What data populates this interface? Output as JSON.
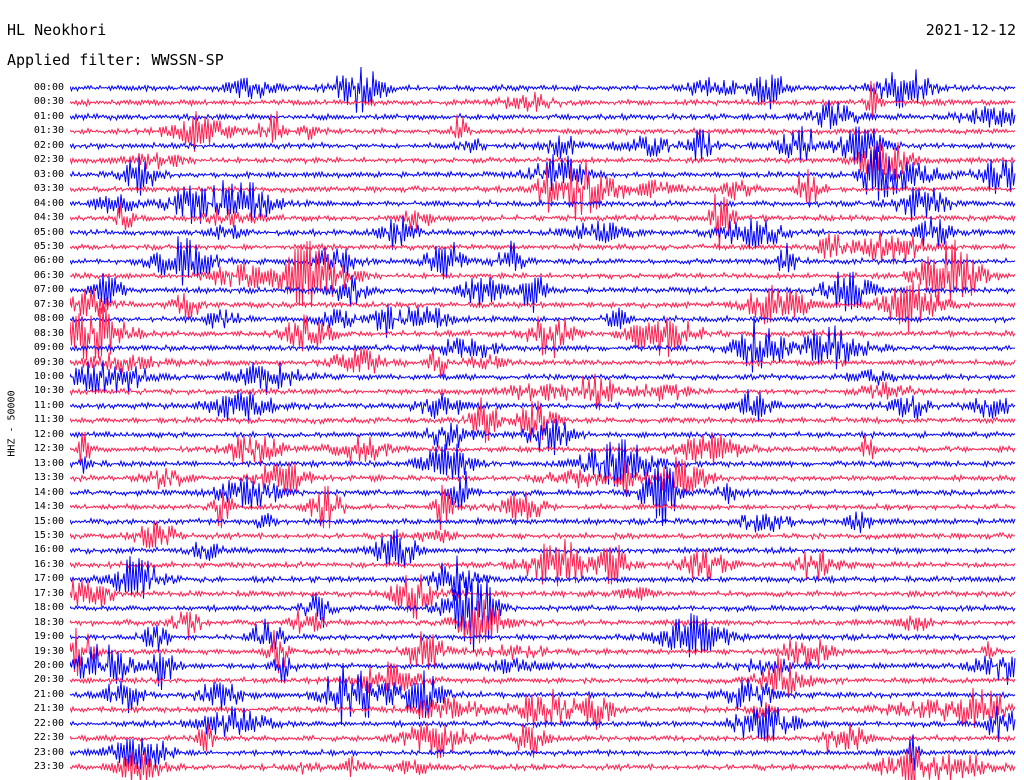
{
  "header": {
    "station": "HL Neokhori",
    "date": "2021-12-12",
    "filter": "Applied filter: WWSSN-SP"
  },
  "axis": {
    "channel_label": "HHZ - 50000"
  },
  "rows": [
    "00:00",
    "00:30",
    "01:00",
    "01:30",
    "02:00",
    "02:30",
    "03:00",
    "03:30",
    "04:00",
    "04:30",
    "05:00",
    "05:30",
    "06:00",
    "06:30",
    "07:00",
    "07:30",
    "08:00",
    "08:30",
    "09:00",
    "09:30",
    "10:00",
    "10:30",
    "11:00",
    "11:30",
    "12:00",
    "12:30",
    "13:00",
    "13:30",
    "14:00",
    "14:30",
    "15:00",
    "15:30",
    "16:00",
    "16:30",
    "17:00",
    "17:30",
    "18:00",
    "18:30",
    "19:00",
    "19:30",
    "20:00",
    "20:30",
    "21:00",
    "21:30",
    "22:00",
    "22:30",
    "23:00",
    "23:30"
  ],
  "colors": {
    "trace_a": "#0000ff",
    "trace_b": "#ff2050"
  }
}
